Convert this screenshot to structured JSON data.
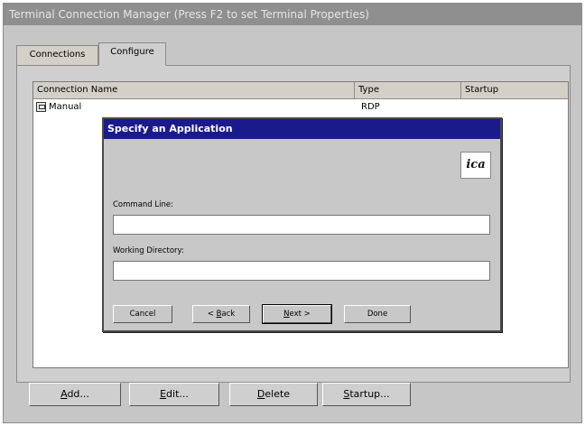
{
  "window": {
    "title": "Terminal Connection Manager (Press F2 to set Terminal Properties)"
  },
  "tabs": [
    {
      "label": "Connections"
    },
    {
      "label": "Configure"
    }
  ],
  "list": {
    "columns": [
      "Connection Name",
      "Type",
      "Startup"
    ],
    "rows": [
      {
        "name": "Manual",
        "type": "RDP",
        "startup": ""
      }
    ]
  },
  "dialog": {
    "title": "Specify an Application",
    "logo_text": "ica",
    "command_line_label": "Command Line:",
    "command_line_value": "",
    "working_dir_label": "Working Directory:",
    "working_dir_value": "",
    "buttons": {
      "cancel": "Cancel",
      "back_prefix": "< ",
      "back_key": "B",
      "back_rest": "ack",
      "next_key": "N",
      "next_rest": "ext >",
      "done": "Done"
    }
  },
  "buttons": {
    "add_key": "A",
    "add_rest": "dd...",
    "edit_key": "E",
    "edit_rest": "dit...",
    "delete_key": "D",
    "delete_rest": "elete",
    "startup_key": "S",
    "startup_rest": "tartup..."
  }
}
